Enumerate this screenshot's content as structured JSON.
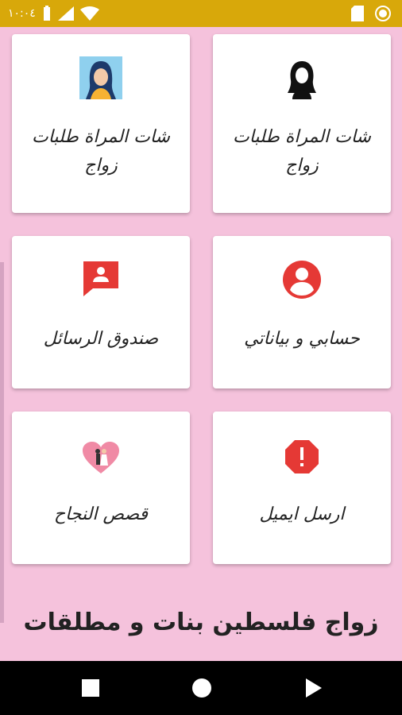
{
  "status_bar": {
    "time": "١٠:٠٤",
    "icons": [
      "battery-icon",
      "signal-icon",
      "wifi-icon",
      "sd-card-icon",
      "record-icon"
    ]
  },
  "cards": [
    {
      "label": "شات المراة طلبات زواج",
      "icon": "woman-silhouette-icon"
    },
    {
      "label": "شات المراة طلبات زواج",
      "icon": "woman-avatar-icon"
    },
    {
      "label": "حسابي و بياناتي",
      "icon": "account-circle-icon"
    },
    {
      "label": "صندوق الرسائل",
      "icon": "message-user-icon"
    },
    {
      "label": "ارسل ايميل",
      "icon": "error-octagon-icon"
    },
    {
      "label": "قصص النجاح",
      "icon": "couple-heart-icon"
    }
  ],
  "app_title": "زواج فلسطين بنات و مطلقات",
  "nav": {
    "icons": [
      "square-icon",
      "circle-icon",
      "triangle-play-icon"
    ]
  },
  "colors": {
    "status_bar": "#d8a80a",
    "background": "#f5c2dc",
    "accent_red": "#e53935"
  }
}
